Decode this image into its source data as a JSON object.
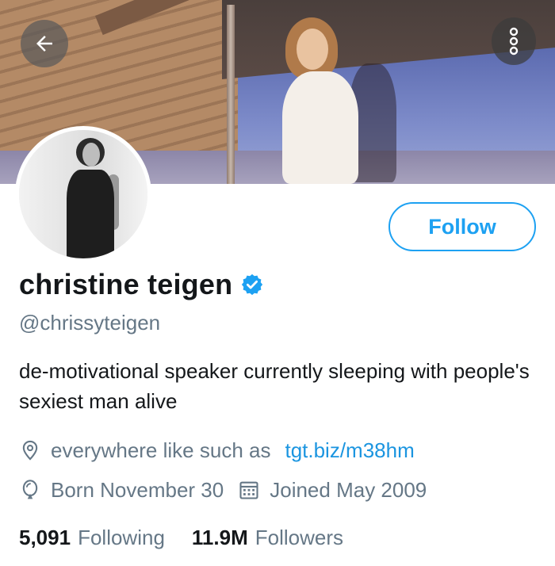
{
  "header": {
    "back_icon": "arrow-left-icon",
    "more_icon": "more-vertical-icon"
  },
  "profile": {
    "display_name": "christine teigen",
    "verified": true,
    "handle": "@chrissyteigen",
    "follow_label": "Follow",
    "bio": "de-motivational speaker currently sleeping with people's sexiest man alive",
    "location": "everywhere like such as",
    "url": "tgt.biz/m38hm",
    "birthday": "Born November 30",
    "joined": "Joined May 2009"
  },
  "stats": {
    "following_count": "5,091",
    "following_label": "Following",
    "followers_count": "11.9M",
    "followers_label": "Followers"
  },
  "colors": {
    "accent": "#1da1f2",
    "link": "#1b95e0",
    "secondary_text": "#657786",
    "primary_text": "#14171a"
  }
}
